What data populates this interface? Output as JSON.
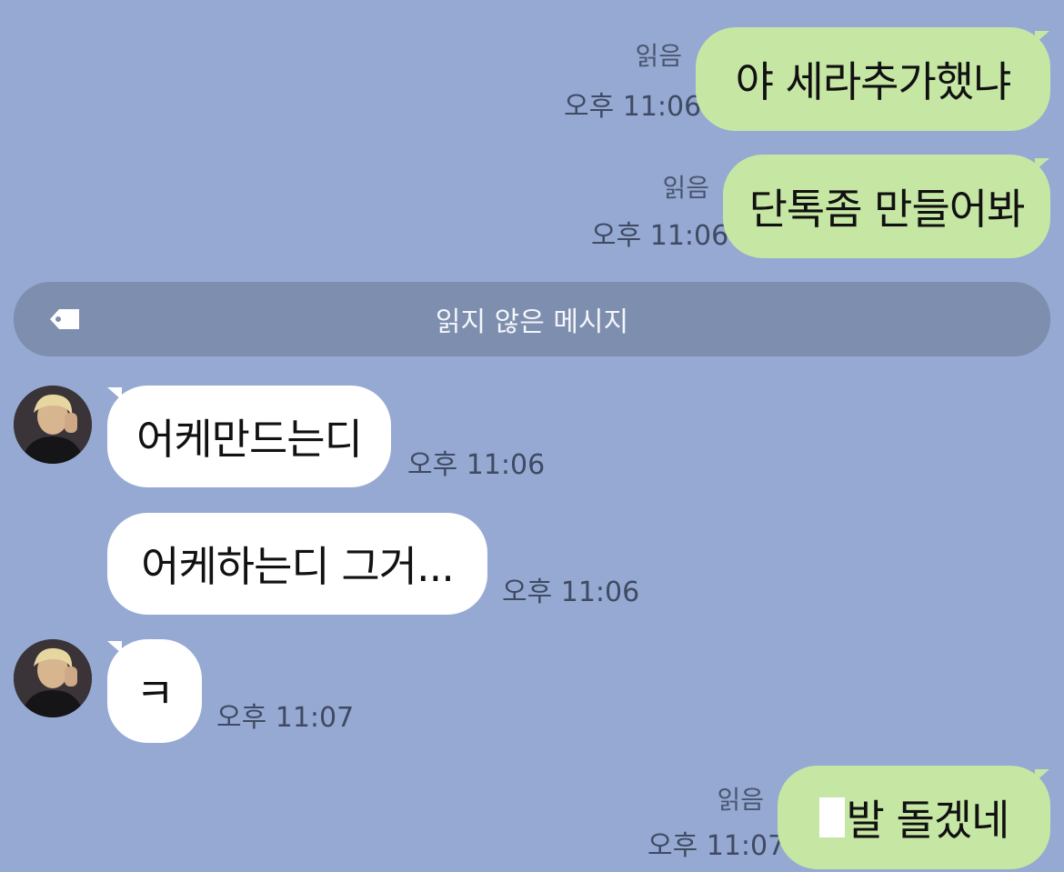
{
  "messages": {
    "out1": {
      "text": "야 세라추가했냐",
      "read": "읽음",
      "time": "오후 11:06"
    },
    "out2": {
      "text": "단톡좀 만들어봐",
      "read": "읽음",
      "time": "오후 11:06"
    },
    "in1": {
      "text": "어케만드는디",
      "time": "오후 11:06"
    },
    "in2": {
      "text": "어케하는디 그거...",
      "time": "오후 11:06"
    },
    "in3": {
      "text": "ㅋ",
      "time": "오후 11:07"
    },
    "out3": {
      "text": "발 돌겠네",
      "read": "읽음",
      "time": "오후 11:07"
    }
  },
  "divider": {
    "label": "읽지 않은 메시지",
    "icon": "tag-icon"
  },
  "colors": {
    "background": "#95a9d2",
    "outgoing_bubble": "#c6e6a4",
    "incoming_bubble": "#ffffff",
    "divider": "#7e8eae"
  }
}
